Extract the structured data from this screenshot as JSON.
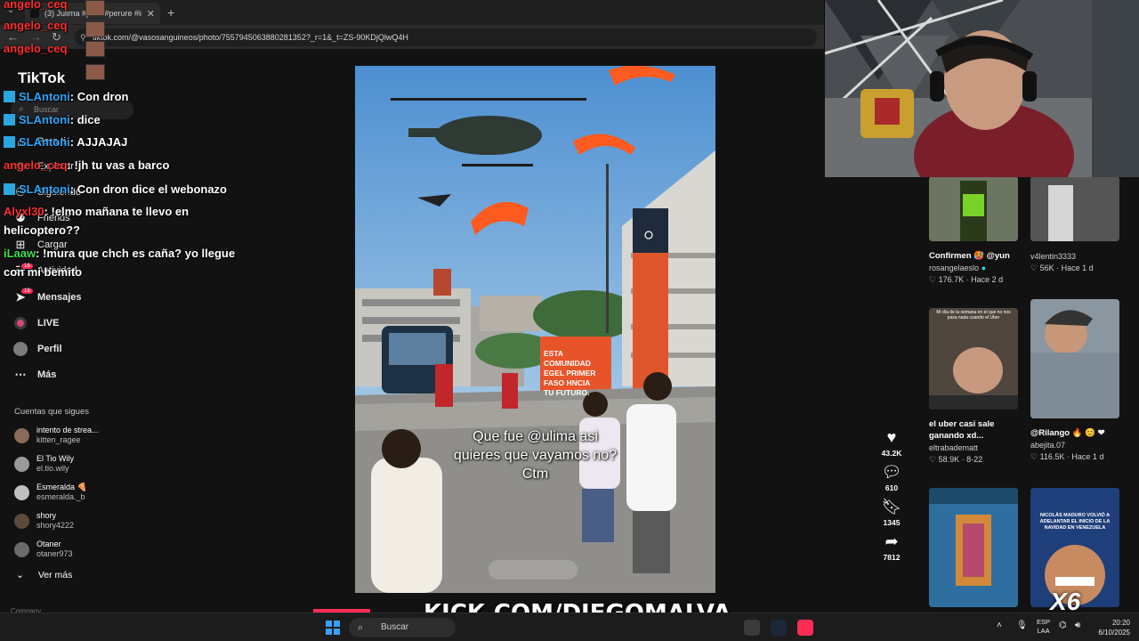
{
  "browser": {
    "tab_title": "(3) Julima #paro #perure #indi",
    "url": "tiktok.com/@vasosanguineos/photo/7557945063880281352?_r=1&_t=ZS-90KDjQlwQ4H"
  },
  "sidebar": {
    "logo": "TikTok",
    "search_placeholder": "Buscar",
    "items": [
      {
        "label": "Para ti",
        "icon": "home-icon"
      },
      {
        "label": "Explorar",
        "icon": "compass-icon"
      },
      {
        "label": "Siguiendo",
        "icon": "following-icon"
      },
      {
        "label": "Friends",
        "icon": "friends-icon"
      },
      {
        "label": "Cargar",
        "icon": "upload-icon"
      },
      {
        "label": "Actividad",
        "icon": "activity-icon"
      },
      {
        "label": "Mensajes",
        "icon": "messages-icon"
      },
      {
        "label": "LIVE",
        "icon": "live-icon"
      },
      {
        "label": "Perfil",
        "icon": "profile-icon"
      },
      {
        "label": "Más",
        "icon": "more-icon"
      }
    ],
    "badges": {
      "activity": "16",
      "messages": "19"
    },
    "following_title": "Cuentas que sigues",
    "following": [
      {
        "name": "intento de strea...",
        "handle": "kitten_ragee"
      },
      {
        "name": "El Tio Wily",
        "handle": "el.tio.wily"
      },
      {
        "name": "Esmeralda 🍕",
        "handle": "esmeralda._b"
      },
      {
        "name": "shory",
        "handle": "shory4222"
      },
      {
        "name": "Otaner",
        "handle": "otaner973"
      }
    ],
    "see_more": "Ver más",
    "company": "Company"
  },
  "chat": [
    {
      "user": "angelo_ceq",
      "text": "",
      "color": "red"
    },
    {
      "user": "angelo_ceq",
      "text": "",
      "color": "red"
    },
    {
      "user": "angelo_ceq",
      "text": "",
      "color": "red"
    },
    {
      "user": "SLAntoni",
      "text": ": Con dron",
      "color": "blue"
    },
    {
      "user": "SLAntoni",
      "text": ": dice",
      "color": "blue"
    },
    {
      "user": "SLAntoni",
      "text": ": AJJAJAJ",
      "color": "blue"
    },
    {
      "user": "angelo_ceq",
      "text": ": !jh tu vas a barco",
      "color": "red"
    },
    {
      "user": "SLAntoni",
      "text": ": Con dron dice el webonazo",
      "color": "blue"
    },
    {
      "user": "Alyxl30",
      "text": ": !elmo mañana te llevo en",
      "color": "red"
    },
    {
      "user": "",
      "text": "helicoptero??",
      "color": "none"
    },
    {
      "user": "iLaaw",
      "text": ": !mura que chch es caña? yo llegue",
      "color": "green"
    },
    {
      "user": "",
      "text": "con mi bemito",
      "color": "none"
    }
  ],
  "video": {
    "caption_lines": [
      "Que fue @ulima asi",
      "quieres que vayamos no?",
      "Ctm"
    ],
    "sign_text": [
      "ESTA COMUNIDAD",
      "EGEL PRIMER",
      "FASO HNCIA",
      "TU FUTURO."
    ]
  },
  "actions": {
    "likes": "43.2K",
    "comments": "610",
    "saves": "1345",
    "shares": "7812"
  },
  "creator": {
    "name": "vasosanguineos"
  },
  "related": [
    {
      "title": "Confirmen 🥵 @yun",
      "author": "rosangelaeslo",
      "verified": true,
      "meta": "♡ 176.7K · Hace 2 d"
    },
    {
      "title": "",
      "author": "v4lentin3333",
      "verified": false,
      "meta": "♡ 56K · Hace 1 d"
    },
    {
      "title": "el uber casi sale ganando xd...",
      "author": "eltrabadematt",
      "verified": false,
      "meta": "♡ 58.9K · 8-22"
    },
    {
      "title": "@Rilango 🔥 😊 ❤",
      "author": "abejita.07",
      "verified": false,
      "meta": "♡ 116.5K · Hace 1 d"
    },
    {
      "title": "",
      "author": "",
      "verified": false,
      "meta": ""
    },
    {
      "title": "",
      "author": "",
      "verified": false,
      "meta": ""
    }
  ],
  "related_thumb_text": {
    "card3": "Mi día de la semana en el que no nos pasa nada cuando el Uber",
    "card6": "NICOLÁS MADURO VOLVIÓ A ADELANTAR EL INICIO DE LA NAVIDAD EN VENEZUELA"
  },
  "overlay": {
    "kick": "KICK.COM/DIEGOMALVA",
    "multiplier": "X6"
  },
  "taskbar": {
    "search_placeholder": "Buscar",
    "lang_line1": "ESP",
    "lang_line2": "LAA",
    "time": "20:20",
    "date": "6/10/2025"
  },
  "colors": {
    "accent": "#fe2c55",
    "chat_blue": "#29a7ff",
    "chat_red": "#ff2e2e",
    "chat_green": "#3fe04a",
    "sign_orange": "#e8542a"
  }
}
